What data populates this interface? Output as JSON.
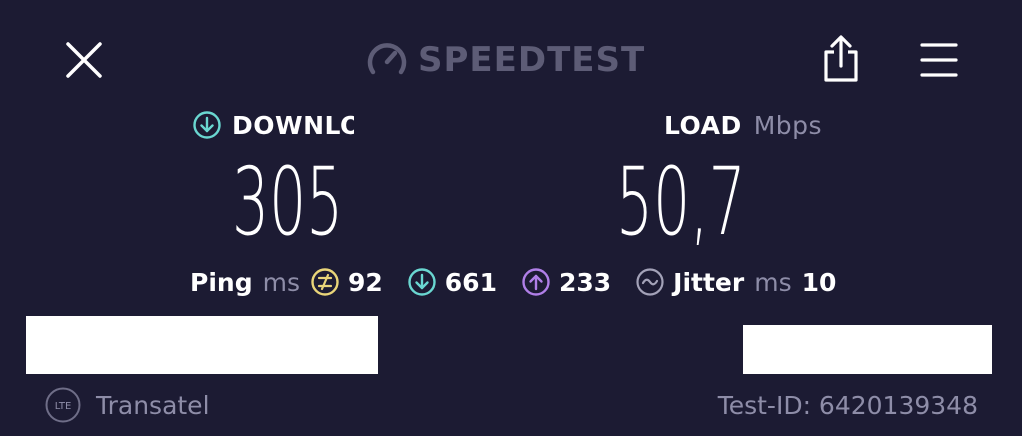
{
  "header": {
    "brand": "SPEEDTEST",
    "close_icon": "close-icon",
    "share_icon": "share-icon",
    "menu_icon": "hamburger-menu-icon"
  },
  "download": {
    "label": "DOWNLOAD",
    "value": "305",
    "icon": "download-arrow-icon",
    "color": "#6ad7d1"
  },
  "upload": {
    "label_visible": "LOAD",
    "unit": "Mbps",
    "value": "50,7",
    "icon": "upload-arrow-icon",
    "color": "#b07fe8"
  },
  "metrics": {
    "ping_label": "Ping",
    "ping_unit": "ms",
    "idle_ping": "92",
    "idle_color": "#e9d579",
    "download_ping": "661",
    "upload_ping": "233",
    "jitter_label": "Jitter",
    "jitter_unit": "ms",
    "jitter_value": "10"
  },
  "footer": {
    "network_type": "LTE",
    "carrier": "Transatel",
    "test_id": "Test-ID: 6420139348"
  }
}
